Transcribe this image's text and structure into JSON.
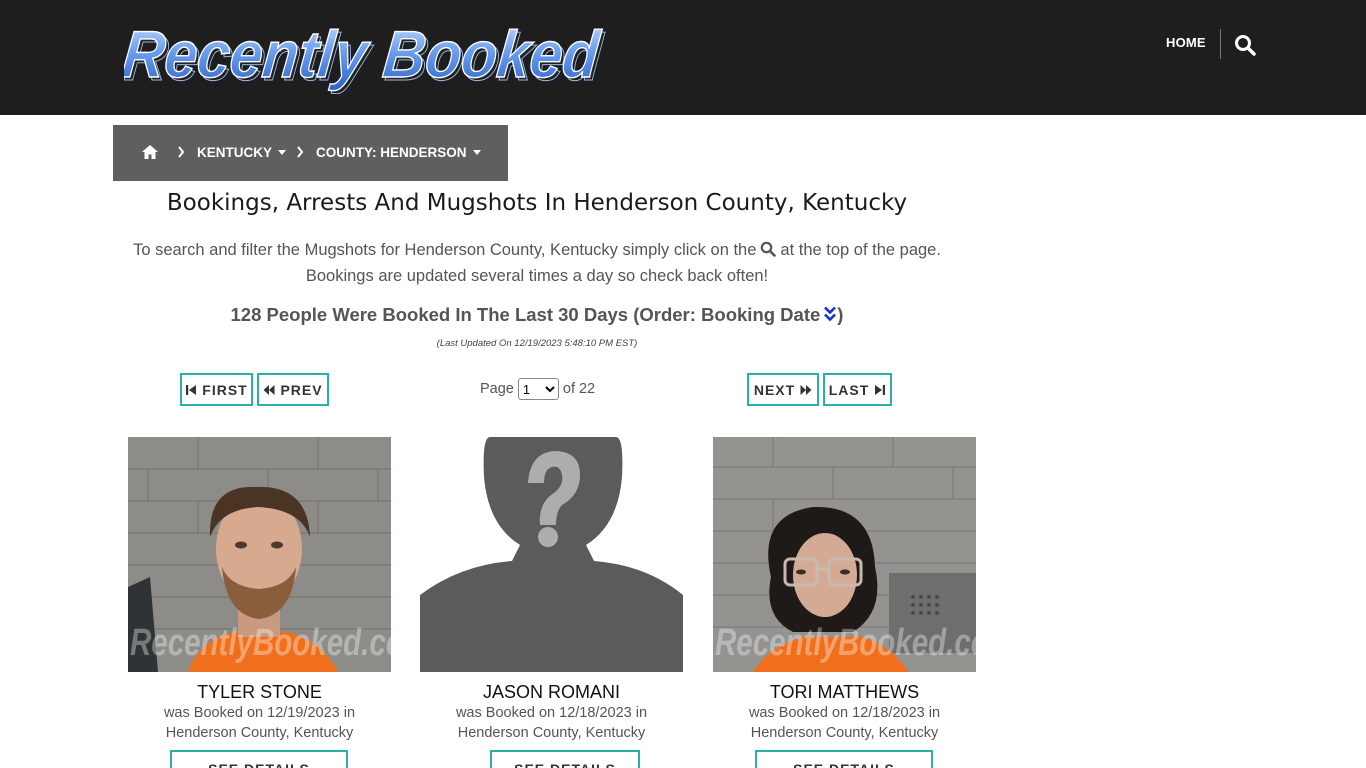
{
  "header": {
    "logo_text": "Recently Booked",
    "nav_home": "HOME",
    "search_icon": "search-icon"
  },
  "breadcrumb": {
    "home_icon": "home-icon",
    "state": "KENTUCKY",
    "county": "COUNTY: HENDERSON"
  },
  "main": {
    "title": "Bookings, Arrests And Mugshots In Henderson County, Kentucky",
    "intro_line1_before": "To search and filter the Mugshots for Henderson County, Kentucky simply click on the",
    "intro_line1_after": "at the top of the page.",
    "intro_line2": "Bookings are updated several times a day so check back often!",
    "summary_before": "128 People Were Booked In The Last 30 Days (Order: Booking Date",
    "summary_after": ")",
    "last_updated": "(Last Updated On 12/19/2023 5:48:10 PM EST)"
  },
  "pagination": {
    "first": "FIRST",
    "prev": "PREV",
    "next": "NEXT",
    "last": "LAST",
    "page_label": "Page",
    "page_value": "1",
    "of_label": "of 22"
  },
  "cards": [
    {
      "name": "TYLER STONE",
      "booked_line1": "was Booked on 12/19/2023 in",
      "booked_line2": "Henderson County, Kentucky",
      "watermark": "RecentlyBooked.com",
      "button": "SEE DETAILS"
    },
    {
      "name": "JASON ROMANI",
      "booked_line1": "was Booked on 12/18/2023 in",
      "booked_line2": "Henderson County, Kentucky",
      "button": "SEE DETAILS"
    },
    {
      "name": "TORI MATTHEWS",
      "booked_line1": "was Booked on 12/18/2023 in",
      "booked_line2": "Henderson County, Kentucky",
      "watermark": "RecentlyBooked.com",
      "button": "SEE DETAILS"
    }
  ],
  "colors": {
    "header_bg": "#1e1e1e",
    "breadcrumb_bg": "#5f5f5f",
    "accent_teal": "#2bb0a8",
    "logo_blue": "#5f95ee"
  }
}
